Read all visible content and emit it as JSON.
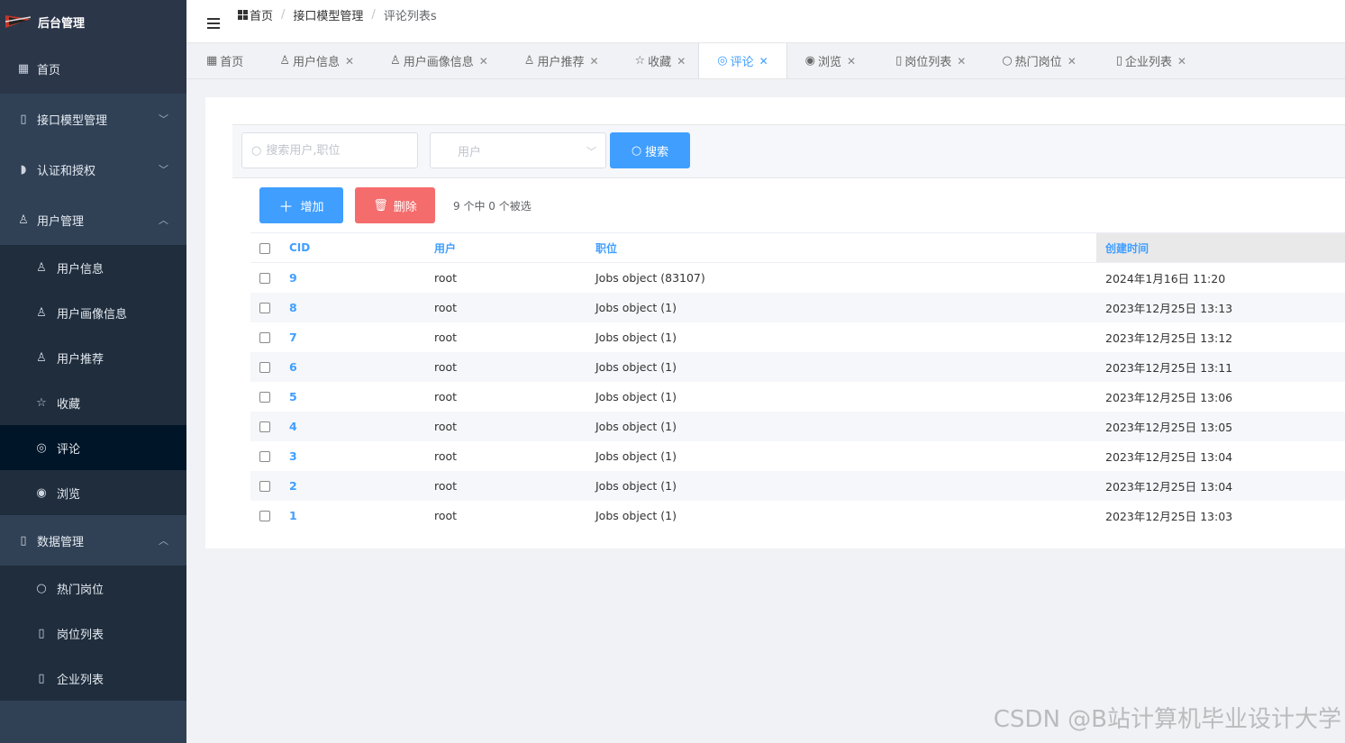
{
  "app": {
    "title": "后台管理"
  },
  "breadcrumb": {
    "items": [
      "首页",
      "接口模型管理",
      "评论列表s"
    ]
  },
  "sidebar": {
    "home": "首页",
    "api_model": "接口模型管理",
    "auth": "认证和授权",
    "user_mgmt": "用户管理",
    "user_items": [
      "用户信息",
      "用户画像信息",
      "用户推荐",
      "收藏",
      "评论",
      "浏览"
    ],
    "data_mgmt": "数据管理",
    "data_items": [
      "热门岗位",
      "岗位列表",
      "企业列表"
    ]
  },
  "tags": [
    "首页",
    "用户信息",
    "用户画像信息",
    "用户推荐",
    "收藏",
    "评论",
    "浏览",
    "岗位列表",
    "热门岗位",
    "企业列表"
  ],
  "filter": {
    "search_placeholder": "搜索用户,职位",
    "select_value": "用户",
    "search_button": "搜索"
  },
  "actions": {
    "add": "增加",
    "delete": "删除",
    "selection": "9 个中 0 个被选"
  },
  "table": {
    "headers": [
      "CID",
      "用户",
      "职位",
      "创建时间"
    ],
    "rows": [
      {
        "cid": "9",
        "user": "root",
        "job": "Jobs object (83107)",
        "time": "2024年1月16日 11:20"
      },
      {
        "cid": "8",
        "user": "root",
        "job": "Jobs object (1)",
        "time": "2023年12月25日 13:13"
      },
      {
        "cid": "7",
        "user": "root",
        "job": "Jobs object (1)",
        "time": "2023年12月25日 13:12"
      },
      {
        "cid": "6",
        "user": "root",
        "job": "Jobs object (1)",
        "time": "2023年12月25日 13:11"
      },
      {
        "cid": "5",
        "user": "root",
        "job": "Jobs object (1)",
        "time": "2023年12月25日 13:06"
      },
      {
        "cid": "4",
        "user": "root",
        "job": "Jobs object (1)",
        "time": "2023年12月25日 13:05"
      },
      {
        "cid": "3",
        "user": "root",
        "job": "Jobs object (1)",
        "time": "2023年12月25日 13:04"
      },
      {
        "cid": "2",
        "user": "root",
        "job": "Jobs object (1)",
        "time": "2023年12月25日 13:04"
      },
      {
        "cid": "1",
        "user": "root",
        "job": "Jobs object (1)",
        "time": "2023年12月25日 13:03"
      }
    ]
  },
  "watermark": "CSDN @B站计算机毕业设计大学",
  "colors": {
    "sidebar": "#304156",
    "accent": "#409eff",
    "danger": "#f56c6c"
  }
}
